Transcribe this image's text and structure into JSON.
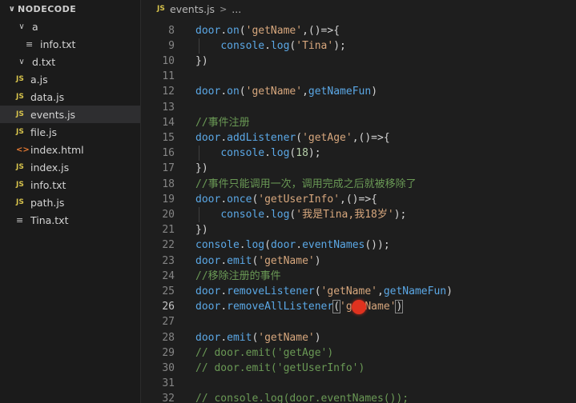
{
  "explorer": {
    "title": "NODECODE",
    "items": [
      {
        "label": "a",
        "kind": "folder",
        "expanded": true,
        "depth": 1
      },
      {
        "label": "info.txt",
        "kind": "txt",
        "depth": 2
      },
      {
        "label": "d.txt",
        "kind": "folder",
        "expanded": true,
        "depth": 1
      },
      {
        "label": "a.js",
        "kind": "js",
        "depth": 1
      },
      {
        "label": "data.js",
        "kind": "js",
        "depth": 1
      },
      {
        "label": "events.js",
        "kind": "js",
        "depth": 1,
        "selected": true
      },
      {
        "label": "file.js",
        "kind": "js",
        "depth": 1
      },
      {
        "label": "index.html",
        "kind": "html",
        "depth": 1
      },
      {
        "label": "index.js",
        "kind": "js",
        "depth": 1
      },
      {
        "label": "info.txt",
        "kind": "js",
        "depth": 1
      },
      {
        "label": "path.js",
        "kind": "js",
        "depth": 1
      },
      {
        "label": "Tina.txt",
        "kind": "txt",
        "depth": 1
      }
    ]
  },
  "breadcrumb": {
    "file_icon": "JS",
    "file": "events.js",
    "separator": ">",
    "rest": "..."
  },
  "icons": {
    "js": "JS",
    "txt": "≡",
    "html": "<>",
    "chevron_down": "∨"
  },
  "colors": {
    "identifier": "#5ba8e6",
    "string": "#d7a77d",
    "number": "#b5cea8",
    "comment": "#6a9955",
    "cursor": "#e0321f"
  },
  "code": {
    "active_line": 26,
    "lines": [
      {
        "n": "8",
        "tokens": [
          [
            "id",
            "door"
          ],
          [
            "pun",
            "."
          ],
          [
            "fn",
            "on"
          ],
          [
            "pun",
            "("
          ],
          [
            "str",
            "'getName'"
          ],
          [
            "pun",
            ",()=>{"
          ]
        ]
      },
      {
        "n": "9",
        "tokens": [
          [
            "wh",
            "    "
          ],
          [
            "id",
            "console"
          ],
          [
            "pun",
            "."
          ],
          [
            "fn",
            "log"
          ],
          [
            "pun",
            "("
          ],
          [
            "str",
            "'Tina'"
          ],
          [
            "pun",
            ");"
          ]
        ]
      },
      {
        "n": "10",
        "tokens": [
          [
            "pun",
            "})"
          ]
        ]
      },
      {
        "n": "11",
        "tokens": []
      },
      {
        "n": "12",
        "tokens": [
          [
            "id",
            "door"
          ],
          [
            "pun",
            "."
          ],
          [
            "fn",
            "on"
          ],
          [
            "pun",
            "("
          ],
          [
            "str",
            "'getName'"
          ],
          [
            "pun",
            ","
          ],
          [
            "id",
            "getNameFun"
          ],
          [
            "pun",
            ")"
          ]
        ]
      },
      {
        "n": "13",
        "tokens": []
      },
      {
        "n": "14",
        "tokens": [
          [
            "cm",
            "//事件注册"
          ]
        ]
      },
      {
        "n": "15",
        "tokens": [
          [
            "id",
            "door"
          ],
          [
            "pun",
            "."
          ],
          [
            "fn",
            "addListener"
          ],
          [
            "pun",
            "("
          ],
          [
            "str",
            "'getAge'"
          ],
          [
            "pun",
            ",()=>{"
          ]
        ]
      },
      {
        "n": "16",
        "tokens": [
          [
            "wh",
            "    "
          ],
          [
            "id",
            "console"
          ],
          [
            "pun",
            "."
          ],
          [
            "fn",
            "log"
          ],
          [
            "pun",
            "("
          ],
          [
            "num",
            "18"
          ],
          [
            "pun",
            ");"
          ]
        ]
      },
      {
        "n": "17",
        "tokens": [
          [
            "pun",
            "})"
          ]
        ]
      },
      {
        "n": "18",
        "tokens": [
          [
            "cm",
            "//事件只能调用一次，调用完成之后就被移除了"
          ]
        ]
      },
      {
        "n": "19",
        "tokens": [
          [
            "id",
            "door"
          ],
          [
            "pun",
            "."
          ],
          [
            "fn",
            "once"
          ],
          [
            "pun",
            "("
          ],
          [
            "str",
            "'getUserInfo'"
          ],
          [
            "pun",
            ",()=>{"
          ]
        ]
      },
      {
        "n": "20",
        "tokens": [
          [
            "wh",
            "    "
          ],
          [
            "id",
            "console"
          ],
          [
            "pun",
            "."
          ],
          [
            "fn",
            "log"
          ],
          [
            "pun",
            "("
          ],
          [
            "str",
            "'我是Tina,我18岁'"
          ],
          [
            "pun",
            ");"
          ]
        ]
      },
      {
        "n": "21",
        "tokens": [
          [
            "pun",
            "})"
          ]
        ]
      },
      {
        "n": "22",
        "tokens": [
          [
            "id",
            "console"
          ],
          [
            "pun",
            "."
          ],
          [
            "fn",
            "log"
          ],
          [
            "pun",
            "("
          ],
          [
            "id",
            "door"
          ],
          [
            "pun",
            "."
          ],
          [
            "fn",
            "eventNames"
          ],
          [
            "pun",
            "());"
          ]
        ]
      },
      {
        "n": "23",
        "tokens": [
          [
            "id",
            "door"
          ],
          [
            "pun",
            "."
          ],
          [
            "fn",
            "emit"
          ],
          [
            "pun",
            "("
          ],
          [
            "str",
            "'getName'"
          ],
          [
            "pun",
            ")"
          ]
        ]
      },
      {
        "n": "24",
        "tokens": [
          [
            "cm",
            "//移除注册的事件"
          ]
        ]
      },
      {
        "n": "25",
        "tokens": [
          [
            "id",
            "door"
          ],
          [
            "pun",
            "."
          ],
          [
            "fn",
            "removeListener"
          ],
          [
            "pun",
            "("
          ],
          [
            "str",
            "'getName'"
          ],
          [
            "pun",
            ","
          ],
          [
            "id",
            "getNameFun"
          ],
          [
            "pun",
            ")"
          ]
        ]
      },
      {
        "n": "26",
        "tokens": [
          [
            "id",
            "door"
          ],
          [
            "pun",
            "."
          ],
          [
            "fn",
            "removeAllListener"
          ],
          [
            "hl",
            "("
          ],
          [
            "str",
            "'getName'"
          ],
          [
            "hl",
            ")"
          ]
        ]
      },
      {
        "n": "27",
        "tokens": []
      },
      {
        "n": "28",
        "tokens": [
          [
            "id",
            "door"
          ],
          [
            "pun",
            "."
          ],
          [
            "fn",
            "emit"
          ],
          [
            "pun",
            "("
          ],
          [
            "str",
            "'getName'"
          ],
          [
            "pun",
            ")"
          ]
        ]
      },
      {
        "n": "29",
        "tokens": [
          [
            "cm",
            "// door.emit('getAge')"
          ]
        ]
      },
      {
        "n": "30",
        "tokens": [
          [
            "cm",
            "// door.emit('getUserInfo')"
          ]
        ]
      },
      {
        "n": "31",
        "tokens": []
      },
      {
        "n": "32",
        "tokens": [
          [
            "cm",
            "// console.log(door.eventNames());"
          ]
        ]
      }
    ]
  }
}
